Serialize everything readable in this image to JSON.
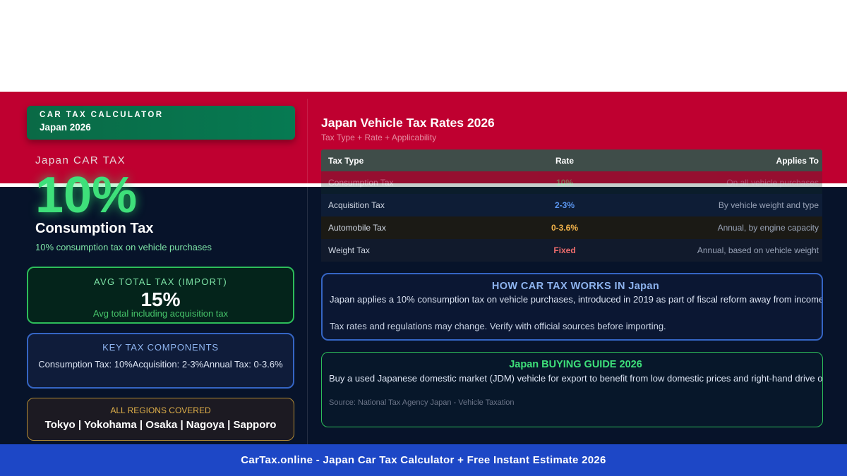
{
  "brand": {
    "kicker": "CAR TAX CALCULATOR",
    "subtitle": "Japan 2026"
  },
  "hero": {
    "country_label": "Japan CAR TAX",
    "rate": "10%",
    "title": "Consumption Tax",
    "description": "10% consumption tax on vehicle purchases"
  },
  "avg_card": {
    "label": "AVG TOTAL TAX (IMPORT)",
    "value": "15%",
    "description": "Avg total including acquisition tax"
  },
  "key_card": {
    "label": "KEY TAX COMPONENTS",
    "items": "Consumption Tax: 10%Acquisition: 2-3%Annual Tax: 0-3.6%"
  },
  "regions_card": {
    "label": "ALL REGIONS COVERED",
    "regions": "Tokyo | Yokohama | Osaka | Nagoya | Sapporo"
  },
  "table": {
    "title": "Japan Vehicle Tax Rates 2026",
    "subtitle": "Tax Type + Rate + Applicability",
    "headers": [
      "Tax Type",
      "Rate",
      "Applies To"
    ],
    "rows": [
      {
        "type": "Consumption Tax",
        "rate": "10%",
        "applies": "On all vehicle purchases",
        "color": "#3ee07a"
      },
      {
        "type": "Acquisition Tax",
        "rate": "2-3%",
        "applies": "By vehicle weight and type",
        "color": "#5b96f0"
      },
      {
        "type": "Automobile Tax",
        "rate": "0-3.6%",
        "applies": "Annual, by engine capacity",
        "color": "#f2b34a"
      },
      {
        "type": "Weight Tax",
        "rate": "Fixed",
        "applies": "Annual, based on vehicle weight",
        "color": "#ee6d6d"
      }
    ]
  },
  "how_box": {
    "title": "HOW CAR TAX WORKS IN Japan",
    "text": "Japan applies a 10% consumption tax on vehicle purchases, introduced in 2019 as part of fiscal reform away from income tax. T",
    "note": "Tax rates and regulations may change. Verify with official sources before importing."
  },
  "guide_box": {
    "title": "Japan BUYING GUIDE 2026",
    "text": "Buy a used Japanese domestic market (JDM) vehicle for export to benefit from low domestic prices and right-hand drive orientat",
    "source": "Source: National Tax Agency Japan - Vehicle Taxation"
  },
  "footer": {
    "text": "CarTax.online - Japan Car Tax Calculator + Free Instant Estimate 2026"
  },
  "colors": {
    "flag_red": "#bf0030",
    "background": "#07132a",
    "accent_green": "#3ee07a",
    "footer_blue": "#1d47c6"
  }
}
